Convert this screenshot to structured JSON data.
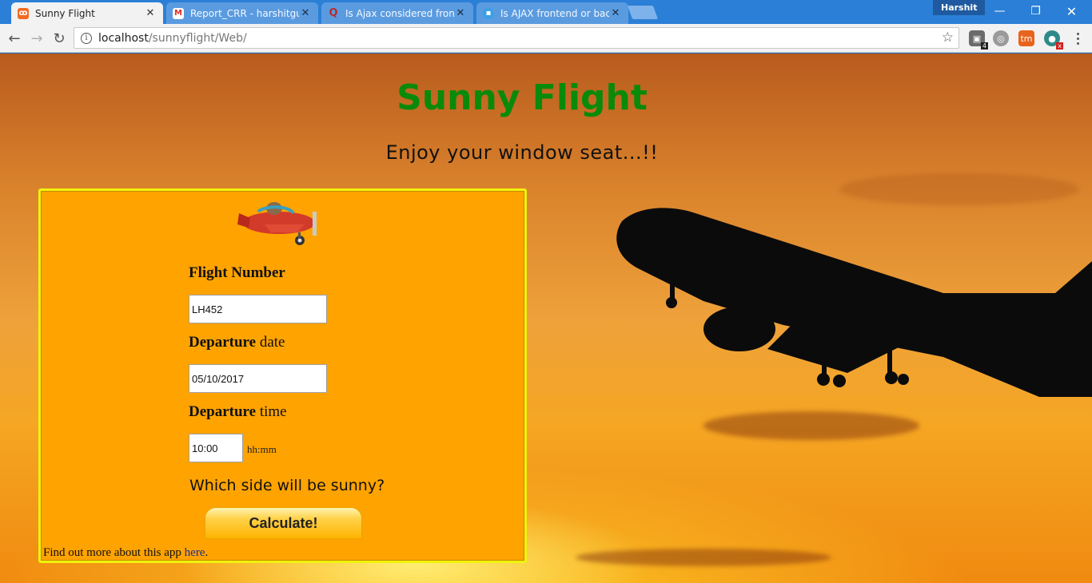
{
  "browser": {
    "tabs": [
      {
        "title": "Sunny Flight",
        "favicon": "xampp-icon",
        "active": true
      },
      {
        "title": "Report_CRR - harshitguj",
        "favicon": "gmail-icon",
        "active": false
      },
      {
        "title": "Is Ajax considered front-",
        "favicon": "quora-icon",
        "active": false
      },
      {
        "title": "Is AJAX frontend or back",
        "favicon": "chat-bubble-icon",
        "active": false
      }
    ],
    "profile_name": "Harshit",
    "window_controls": {
      "minimize": "—",
      "restore": "❐",
      "close": "✕"
    },
    "url_host": "localhost",
    "url_path": "/sunnyflight/Web/",
    "extensions": [
      {
        "name": "extension-badge-icon",
        "badge": "4"
      },
      {
        "name": "extension-globe-icon",
        "badge": ""
      },
      {
        "name": "extension-tm-icon",
        "badge": ""
      },
      {
        "name": "extension-chat-icon",
        "badge": "x"
      }
    ]
  },
  "page": {
    "title": "Sunny Flight",
    "tagline": "Enjoy your window seat...!!",
    "form": {
      "flight_number_label": "Flight Number",
      "flight_number_value": "LH452",
      "departure_date_label_bold": "Departure",
      "departure_date_label_rest": " date",
      "departure_date_value": "05/10/2017",
      "departure_time_label_bold": "Departure",
      "departure_time_label_rest": " time",
      "departure_time_value": "10:00",
      "time_hint": "hh:mm",
      "question": "Which side will be sunny?",
      "calculate_label": "Calculate!"
    },
    "footer_text": "Find out more about this app ",
    "footer_link": "here",
    "footer_end": "."
  },
  "colors": {
    "title_green": "#0a8a0a",
    "card_orange": "#ffa300",
    "card_border": "#f2f20c",
    "chrome_blue": "#2b7fd6"
  }
}
